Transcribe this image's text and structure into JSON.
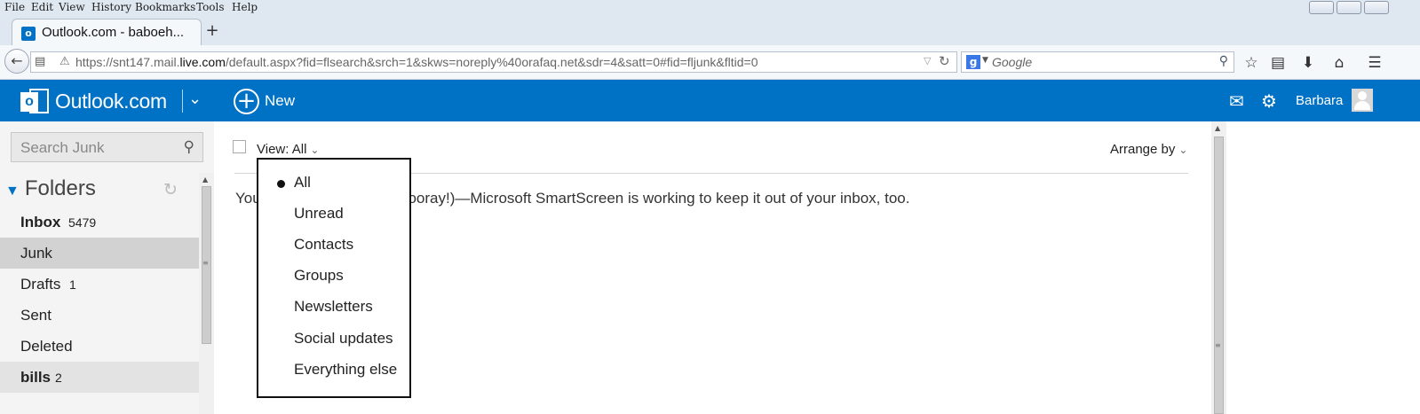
{
  "browser": {
    "menu": [
      "File",
      "Edit",
      "View",
      "History",
      "Bookmarks",
      "Tools",
      "Help"
    ],
    "tab_title": "Outlook.com - baboeh...",
    "new_tab": "+",
    "url_host": "https://snt147.mail.",
    "url_domain": "live.com",
    "url_path": "/default.aspx?fid=flsearch&srch=1&skws=noreply%40orafaq.net&sdr=4&satt=0#fid=fljunk&fltid=0",
    "search_placeholder": "Google"
  },
  "header": {
    "brand": "Outlook.com",
    "new_label": "New",
    "user_name": "Barbara",
    "accent_color": "#0072c6"
  },
  "sidebar": {
    "search_placeholder": "Search Junk",
    "folders_title": "Folders",
    "items": [
      {
        "label": "Inbox",
        "count": "5479"
      },
      {
        "label": "Junk",
        "count": ""
      },
      {
        "label": "Drafts",
        "count": "1"
      },
      {
        "label": "Sent",
        "count": ""
      },
      {
        "label": "Deleted",
        "count": ""
      },
      {
        "label": "bills",
        "count": "2"
      }
    ]
  },
  "main": {
    "view_label": "View: All",
    "arrange_label": "Arrange by",
    "empty_prefix": "You",
    "empty_suffix": "hooray!)—Microsoft SmartScreen is working to keep it out of your inbox, too.",
    "view_options": [
      "All",
      "Unread",
      "Contacts",
      "Groups",
      "Newsletters",
      "Social updates",
      "Everything else"
    ],
    "selected_view": "All"
  }
}
